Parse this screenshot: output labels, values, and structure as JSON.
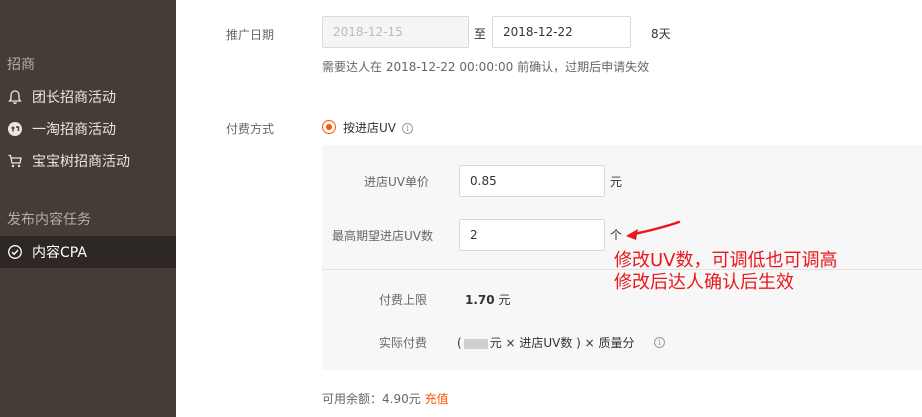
{
  "sidebar": {
    "group1": "招商",
    "items": [
      {
        "label": "团长招商活动",
        "icon": "bell-icon"
      },
      {
        "label": "一淘招商活动",
        "icon": "yitao-logo-icon"
      },
      {
        "label": "宝宝树招商活动",
        "icon": "cart-icon"
      }
    ],
    "group2": "发布内容任务",
    "active_item": {
      "label": "内容CPA",
      "icon": "check-circle-icon"
    }
  },
  "promo_date": {
    "label": "推广日期",
    "start": "2018-12-15",
    "to": "至",
    "end": "2018-12-22",
    "days": "8天",
    "note": "需要达人在 2018-12-22 00:00:00 前确认，过期后申请失效"
  },
  "payment": {
    "label": "付费方式",
    "option": "按进店UV",
    "unit_price_label": "进店UV单价",
    "unit_price_value": "0.85",
    "unit_price_unit": "元",
    "max_uv_label": "最高期望进店UV数",
    "max_uv_value": "2",
    "max_uv_unit": "个",
    "limit_label": "付费上限",
    "limit_value": "1.70",
    "limit_unit": "元",
    "actual_label": "实际付费",
    "actual_formula_prefix": "(",
    "actual_formula_mid": "元 × 进店UV数 ) × 质量分"
  },
  "balance": {
    "label": "可用余额：4.90元",
    "recharge": "充值"
  },
  "annotation": {
    "line1": "修改UV数，可调低也可调高",
    "line2": "修改后达人确认后生效",
    "color": "#e8181b"
  },
  "colors": {
    "accent": "#ff5500",
    "sidebar_bg": "#453c37"
  }
}
